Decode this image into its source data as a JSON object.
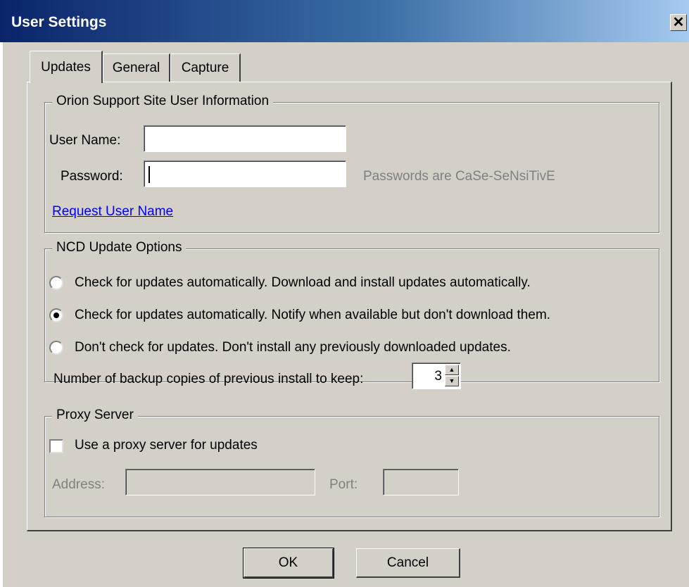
{
  "window": {
    "title": "User Settings",
    "close_label": "✕"
  },
  "tabs": [
    {
      "label": "Updates",
      "active": true
    },
    {
      "label": "General",
      "active": false
    },
    {
      "label": "Capture",
      "active": false
    }
  ],
  "user_info": {
    "legend": "Orion Support Site User Information",
    "username_label": "User Name:",
    "username_value": "",
    "password_label": "Password:",
    "password_value": "",
    "password_hint": "Passwords are CaSe-SeNsiTivE",
    "request_link": "Request User Name"
  },
  "update_options": {
    "legend": "NCD Update Options",
    "options": [
      {
        "label": "Check for updates automatically.  Download and install updates automatically.",
        "selected": false
      },
      {
        "label": "Check for updates automatically.  Notify when available but don't download them.",
        "selected": true
      },
      {
        "label": "Don't check for updates.  Don't install any previously downloaded updates.",
        "selected": false
      }
    ],
    "backup_label": "Number of backup copies of previous install to keep:",
    "backup_value": "3"
  },
  "proxy": {
    "legend": "Proxy Server",
    "use_proxy_label": "Use a proxy server for updates",
    "use_proxy_checked": false,
    "address_label": "Address:",
    "address_value": "",
    "port_label": "Port:",
    "port_value": ""
  },
  "buttons": {
    "ok": "OK",
    "cancel": "Cancel"
  }
}
